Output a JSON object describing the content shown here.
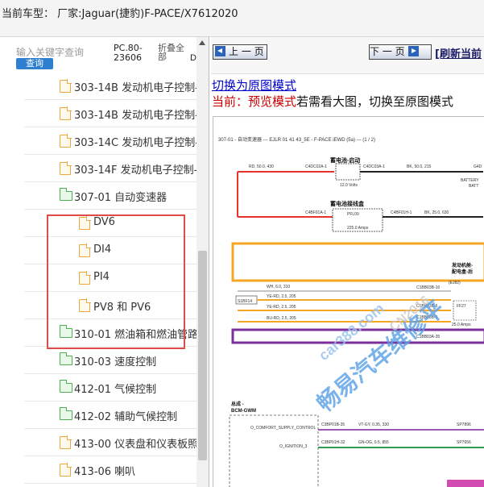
{
  "topbar": {
    "title": "当前车型：  厂家:Jaguar(捷豹)F-PACE/X7612020"
  },
  "search": {
    "placeholder": "输入关键字查询",
    "query_label": "查询",
    "pc_line1": "PC.80-",
    "pc_line2": "23606",
    "fold_line1": "折叠全",
    "fold_line2": "部",
    "d_cut": "D"
  },
  "tree": {
    "items": [
      {
        "label": "303-14B 发动机电子控制-I",
        "type": "file",
        "indent": 0
      },
      {
        "label": "303-14B 发动机电子控制-P",
        "type": "file",
        "indent": 0
      },
      {
        "label": "303-14C 发动机电子控制-D",
        "type": "file",
        "indent": 0
      },
      {
        "label": "303-14F 发动机电子控制-P",
        "type": "file",
        "indent": 0
      },
      {
        "label": "307-01 自动变速器",
        "type": "folder",
        "indent": 0
      },
      {
        "label": "DV6",
        "type": "file",
        "indent": 1
      },
      {
        "label": "DI4",
        "type": "file",
        "indent": 1
      },
      {
        "label": "PI4",
        "type": "file",
        "indent": 1
      },
      {
        "label": "PV8 和 PV6",
        "type": "file",
        "indent": 1
      },
      {
        "label": "310-01 燃油箱和燃油管路",
        "type": "folder",
        "indent": 0
      },
      {
        "label": "310-03 速度控制",
        "type": "folder",
        "indent": 0
      },
      {
        "label": "412-01 气候控制",
        "type": "folder",
        "indent": 0
      },
      {
        "label": "412-02 辅助气候控制",
        "type": "folder",
        "indent": 0
      },
      {
        "label": "413-00 仪表盘和仪表板照E",
        "type": "file",
        "indent": 0
      },
      {
        "label": "413-06 喇叭",
        "type": "file",
        "indent": 0
      }
    ]
  },
  "nav": {
    "prev_label": "上 一 页",
    "next_label": "下 一 页",
    "refresh_label": "[刷新当前"
  },
  "content": {
    "switch_link": "切换为原图模式",
    "mode_prefix": "当前：预览模式",
    "mode_suffix": "若需看大图，切换至原图模式"
  },
  "diagram": {
    "header": "307-01 - 自动变速器 --- EJLR 01 41 43_5E - F-PACE iEWD (5a) --- (1 / 2)",
    "battery_start": "蓄电池-启动",
    "battery_junction": "蓄电池接线盒",
    "wire1": "RD, 50.0, 430",
    "c4dc02a": "C4DC02A-1",
    "c4dc03a": "C4DC03A-1",
    "wire2": "BK, 50.0, 215",
    "g4d": "G4D",
    "volts": "12.0 Volts",
    "battery": "BATTERY",
    "batt": "BATT",
    "c4bf01a": "C4BF01A-1",
    "pfl09": "PFL09",
    "amps225": "225.0 Amps",
    "c4bf01h": "C4BF01H-1",
    "wire3": "BK, 25.0, 630",
    "right_module_1": "发动机舱-",
    "right_module_2": "配电盒-后",
    "wh": "WH, 6.0, 310",
    "s1bf14": "S1BF14",
    "ye1": "YE-RD, 2.5, 205",
    "ye2": "YE-RD, 2.5, 205",
    "bu": "BU-RD, 2.5, 205",
    "c1bb03b": "C1BB03B-16",
    "c1bb03b6": "C1BB03B-6",
    "c1bb03b5": "C1BB03B-5",
    "c1bb03a": "C1BB03A-35",
    "ej82": "(EJ82)",
    "ff27": "FF27",
    "amps25": "25.0 Amps",
    "bcm1": "总成 -",
    "bcm2": "BCM-GWM",
    "o_comfort": "O_COMFORT_SUPPLY_CONTROL",
    "c3bp01b35": "C3BP01B-35",
    "vt": "VT-GY, 0.35, 330",
    "sp7896": "SP7896",
    "o_ignition": "O_IGNITION_3",
    "c3bp01h32": "C3BP01H-32",
    "gn": "GN-OG, 0.5, 855",
    "sp7656": "SP7656",
    "watermark_main": "畅易汽车维修平",
    "watermark_site": "car388.com",
    "watermark_domain": "CN2016"
  },
  "colors": {
    "highlight_box": "#e04a47",
    "orange_wire": "#f5a623",
    "purple_wire": "#7b2f9c",
    "red_wire": "#e8332a",
    "watermark": "#5aa0e6",
    "link": "#0000cc",
    "mode_red": "#cc0000"
  }
}
